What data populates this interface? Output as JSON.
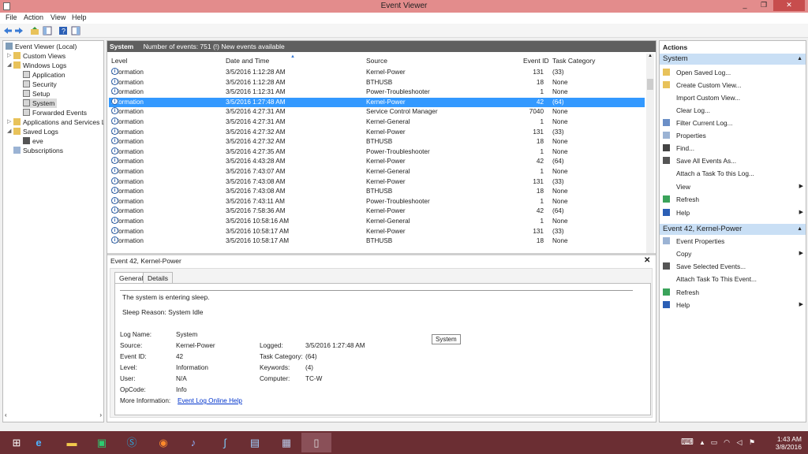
{
  "window": {
    "title": "Event Viewer",
    "min": "_",
    "max": "❐",
    "close": "✕"
  },
  "menu": [
    "File",
    "Action",
    "View",
    "Help"
  ],
  "tree": {
    "root": "Event Viewer (Local)",
    "custom_views": "Custom Views",
    "windows_logs": "Windows Logs",
    "win_children": [
      "Application",
      "Security",
      "Setup",
      "System",
      "Forwarded Events"
    ],
    "apps_services": "Applications and Services Lo",
    "saved_logs": "Saved Logs",
    "saved_children": [
      "eve"
    ],
    "subscriptions": "Subscriptions"
  },
  "center": {
    "header_log": "System",
    "header_info": "Number of events: 751 (!) New events available",
    "columns": [
      "Level",
      "Date and Time",
      "Source",
      "Event ID",
      "Task Category"
    ],
    "rows": [
      [
        "Information",
        "3/5/2016 1:12:28 AM",
        "Kernel-Power",
        "131",
        "(33)"
      ],
      [
        "Information",
        "3/5/2016 1:12:28 AM",
        "BTHUSB",
        "18",
        "None"
      ],
      [
        "Information",
        "3/5/2016 1:12:31 AM",
        "Power-Troubleshooter",
        "1",
        "None"
      ],
      [
        "Information",
        "3/5/2016 1:27:48 AM",
        "Kernel-Power",
        "42",
        "(64)"
      ],
      [
        "Information",
        "3/5/2016 4:27:31 AM",
        "Service Control Manager",
        "7040",
        "None"
      ],
      [
        "Information",
        "3/5/2016 4:27:31 AM",
        "Kernel-General",
        "1",
        "None"
      ],
      [
        "Information",
        "3/5/2016 4:27:32 AM",
        "Kernel-Power",
        "131",
        "(33)"
      ],
      [
        "Information",
        "3/5/2016 4:27:32 AM",
        "BTHUSB",
        "18",
        "None"
      ],
      [
        "Information",
        "3/5/2016 4:27:35 AM",
        "Power-Troubleshooter",
        "1",
        "None"
      ],
      [
        "Information",
        "3/5/2016 4:43:28 AM",
        "Kernel-Power",
        "42",
        "(64)"
      ],
      [
        "Information",
        "3/5/2016 7:43:07 AM",
        "Kernel-General",
        "1",
        "None"
      ],
      [
        "Information",
        "3/5/2016 7:43:08 AM",
        "Kernel-Power",
        "131",
        "(33)"
      ],
      [
        "Information",
        "3/5/2016 7:43:08 AM",
        "BTHUSB",
        "18",
        "None"
      ],
      [
        "Information",
        "3/5/2016 7:43:11 AM",
        "Power-Troubleshooter",
        "1",
        "None"
      ],
      [
        "Information",
        "3/5/2016 7:58:36 AM",
        "Kernel-Power",
        "42",
        "(64)"
      ],
      [
        "Information",
        "3/5/2016 10:58:16 AM",
        "Kernel-General",
        "1",
        "None"
      ],
      [
        "Information",
        "3/5/2016 10:58:17 AM",
        "Kernel-Power",
        "131",
        "(33)"
      ],
      [
        "Information",
        "3/5/2016 10:58:17 AM",
        "BTHUSB",
        "18",
        "None"
      ]
    ],
    "selected_row": 3
  },
  "detail": {
    "title": "Event 42, Kernel-Power",
    "close": "✕",
    "tabs": [
      "General",
      "Details"
    ],
    "message_line1": "The system is entering sleep.",
    "message_line2": "Sleep Reason: System Idle",
    "log_name_label": "Log Name:",
    "log_name": "System",
    "source_label": "Source:",
    "source": "Kernel-Power",
    "logged_label": "Logged:",
    "logged": "3/5/2016 1:27:48 AM",
    "event_id_label": "Event ID:",
    "event_id": "42",
    "task_cat_label": "Task Category:",
    "task_cat": "(64)",
    "level_label": "Level:",
    "level": "Information",
    "keywords_label": "Keywords:",
    "keywords": "(4)",
    "user_label": "User:",
    "user": "N/A",
    "computer_label": "Computer:",
    "computer": "TC-W",
    "opcode_label": "OpCode:",
    "opcode": "Info",
    "more_info_label": "More Information:",
    "more_info_link": "Event Log Online Help",
    "tooltip": "System"
  },
  "actions": {
    "title": "Actions",
    "section1": "System",
    "items1": [
      "Open Saved Log...",
      "Create Custom View...",
      "Import Custom View...",
      "Clear Log...",
      "Filter Current Log...",
      "Properties",
      "Find...",
      "Save All Events As...",
      "Attach a Task To this Log...",
      "View",
      "Refresh",
      "Help"
    ],
    "section2": "Event 42, Kernel-Power",
    "items2": [
      "Event Properties",
      "Copy",
      "Save Selected Events...",
      "Attach Task To This Event...",
      "Refresh",
      "Help"
    ]
  },
  "clock": {
    "time": "1:43 AM",
    "date": "3/8/2016"
  },
  "colors": {
    "titlebar": "#e38c8c",
    "selection": "#3399ff",
    "taskbar": "#6b2e33",
    "section_header": "#c9dff5"
  }
}
